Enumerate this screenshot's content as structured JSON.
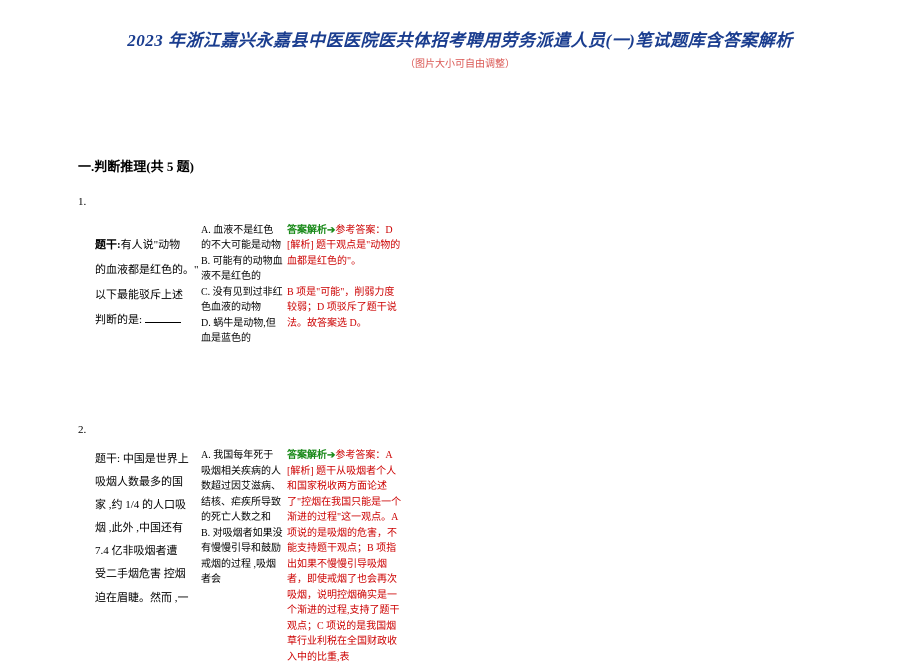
{
  "title": "2023 年浙江嘉兴永嘉县中医医院医共体招考聘用劳务派遣人员(一)笔试题库含答案解析",
  "subtitle": "（图片大小可自由调整）",
  "section": "一.判断推理(共 5 题)",
  "q1": {
    "num": "1.",
    "stem_lead": "题干:",
    "stem_body": "有人说\"动物的血液都是红色的。\"以下最能驳斥上述判断的是:",
    "opts": {
      "a": "A. 血液不是红色的不大可能是动物",
      "b": "B. 可能有的动物血液不是红色的",
      "c": "C. 没有见到过非红色血液的动物",
      "d": "D. 蜗牛是动物,但血是蓝色的"
    },
    "ans_label": "答案解析➔",
    "ans_ref": "参考答案：D",
    "analysis1": "[解析] 题干观点是\"动物的血都是红色的\"。",
    "analysis2": "B 项是\"可能\"，削弱力度较弱；D 项驳斥了题干说法。故答案选 D。"
  },
  "q2": {
    "num": "2.",
    "stem_lead": "题干:",
    "stem_body": "中国是世界上吸烟人数最多的国家 ,约 1/4 的人口吸烟 ,此外 ,中国还有7.4 亿非吸烟者遭受二手烟危害 控烟迫在眉睫。然而 ,一",
    "opts": {
      "a": "A. 我国每年死于吸烟相关疾病的人数超过因艾滋病、结核、疟疾所导致的死亡人数之和",
      "b": "B. 对吸烟者如果没有慢慢引导和鼓励戒烟的过程 ,吸烟者会"
    },
    "ans_label": "答案解析➔",
    "ans_ref": "参考答案：A",
    "analysis": "[解析] 题干从吸烟者个人和国家税收两方面论述了\"控烟在我国只能是一个渐进的过程\"这一观点。A 项说的是吸烟的危害，不能支持题干观点；B 项指出如果不慢慢引导吸烟者，即使戒烟了也会再次吸烟，说明控烟确实是一个渐进的过程,支持了题干观点；C 项说的是我国烟草行业利税在全国财政收入中的比重,表"
  }
}
